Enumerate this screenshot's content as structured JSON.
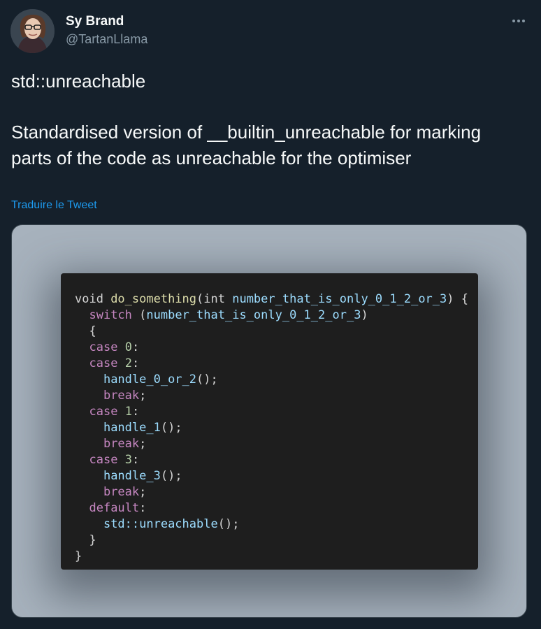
{
  "author": {
    "display_name": "Sy Brand",
    "handle": "@TartanLlama",
    "avatar_icon": "profile-photo"
  },
  "tweet": {
    "text": "std::unreachable\n\nStandardised version of __builtin_unreachable for marking parts of the code as unreachable for the optimiser",
    "translate_label": "Traduire le Tweet"
  },
  "menu": {
    "icon": "more-horizontal-icon"
  },
  "code": {
    "lines": [
      [
        [
          "t",
          "void "
        ],
        [
          "fn",
          "do_something"
        ],
        [
          "t",
          "("
        ],
        [
          "t",
          "int "
        ],
        [
          "var",
          "number_that_is_only_0_1_2_or_3"
        ],
        [
          "t",
          ") {"
        ]
      ],
      [
        [
          "t",
          "  "
        ],
        [
          "kw",
          "switch"
        ],
        [
          "t",
          " ("
        ],
        [
          "var",
          "number_that_is_only_0_1_2_or_3"
        ],
        [
          "t",
          ")"
        ]
      ],
      [
        [
          "t",
          "  {"
        ]
      ],
      [
        [
          "t",
          "  "
        ],
        [
          "kw",
          "case"
        ],
        [
          "t",
          " "
        ],
        [
          "num",
          "0"
        ],
        [
          "t",
          ":"
        ]
      ],
      [
        [
          "t",
          "  "
        ],
        [
          "kw",
          "case"
        ],
        [
          "t",
          " "
        ],
        [
          "num",
          "2"
        ],
        [
          "t",
          ":"
        ]
      ],
      [
        [
          "t",
          "    "
        ],
        [
          "var",
          "handle_0_or_2"
        ],
        [
          "t",
          "();"
        ]
      ],
      [
        [
          "t",
          "    "
        ],
        [
          "kw",
          "break"
        ],
        [
          "t",
          ";"
        ]
      ],
      [
        [
          "t",
          "  "
        ],
        [
          "kw",
          "case"
        ],
        [
          "t",
          " "
        ],
        [
          "num",
          "1"
        ],
        [
          "t",
          ":"
        ]
      ],
      [
        [
          "t",
          "    "
        ],
        [
          "var",
          "handle_1"
        ],
        [
          "t",
          "();"
        ]
      ],
      [
        [
          "t",
          "    "
        ],
        [
          "kw",
          "break"
        ],
        [
          "t",
          ";"
        ]
      ],
      [
        [
          "t",
          "  "
        ],
        [
          "kw",
          "case"
        ],
        [
          "t",
          " "
        ],
        [
          "num",
          "3"
        ],
        [
          "t",
          ":"
        ]
      ],
      [
        [
          "t",
          "    "
        ],
        [
          "var",
          "handle_3"
        ],
        [
          "t",
          "();"
        ]
      ],
      [
        [
          "t",
          "    "
        ],
        [
          "kw",
          "break"
        ],
        [
          "t",
          ";"
        ]
      ],
      [
        [
          "t",
          "  "
        ],
        [
          "kw",
          "default"
        ],
        [
          "t",
          ":"
        ]
      ],
      [
        [
          "t",
          "    "
        ],
        [
          "var",
          "std::unreachable"
        ],
        [
          "t",
          "();"
        ]
      ],
      [
        [
          "t",
          "  }"
        ]
      ],
      [
        [
          "t",
          "}"
        ]
      ]
    ]
  },
  "colors": {
    "background": "#15202b",
    "link": "#1d9bf0",
    "keyword": "#c586c0",
    "function": "#dcdcaa",
    "variable": "#9cdcfe",
    "number": "#b5cea8"
  }
}
